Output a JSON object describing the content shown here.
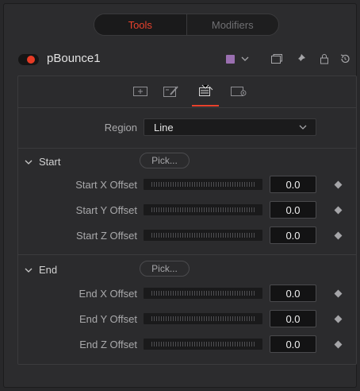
{
  "top_tabs": [
    {
      "label": "Tools",
      "active": true
    },
    {
      "label": "Modifiers",
      "active": false
    }
  ],
  "header": {
    "tool_name": "pBounce1",
    "enabled": true,
    "color_swatch": "#9a6fb0",
    "icons": [
      "chevron-down-icon",
      "window-icon",
      "pin-icon",
      "lock-icon",
      "reset-icon"
    ]
  },
  "sub_tabs": [
    "controls-icon",
    "style-icon",
    "region-icon",
    "settings-icon"
  ],
  "region": {
    "label": "Region",
    "value": "Line"
  },
  "start": {
    "title": "Start",
    "pick_label": "Pick...",
    "rows": [
      {
        "label": "Start X Offset",
        "value": "0.0"
      },
      {
        "label": "Start Y Offset",
        "value": "0.0"
      },
      {
        "label": "Start Z Offset",
        "value": "0.0"
      }
    ]
  },
  "end": {
    "title": "End",
    "pick_label": "Pick...",
    "rows": [
      {
        "label": "End X Offset",
        "value": "0.0"
      },
      {
        "label": "End Y Offset",
        "value": "0.0"
      },
      {
        "label": "End Z Offset",
        "value": "0.0"
      }
    ]
  },
  "colors": {
    "accent": "#e8412c",
    "background": "#2c2c2e"
  }
}
